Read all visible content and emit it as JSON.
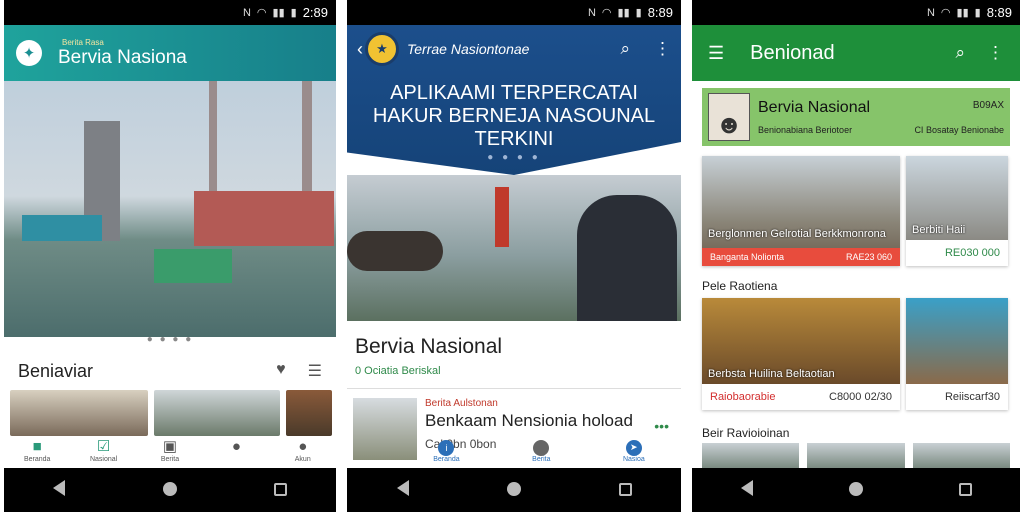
{
  "screens": [
    {
      "status_time": "2:89",
      "appbar": {
        "subtitle": "Berita Rasa",
        "title": "Bervia Nasiona"
      },
      "section": {
        "title": "Beniaviar"
      },
      "bottom_nav": [
        "Beranda",
        "Nasional",
        "Berita",
        "",
        "Akun"
      ]
    },
    {
      "status_time": "8:89",
      "appbar": {
        "title": "Terrae Nasiontonae"
      },
      "headline": "APLIKAAMI TERPERCATAI HAKUR BERNEJA NASOUNAL TERKINI",
      "card": {
        "title": "Bervia Nasional",
        "subtitle": "0 Ociatia Beriskal"
      },
      "list_item": {
        "source": "Berita Aulstonan",
        "title": "Benkaam Nensionia hoload",
        "meta": "Cal 0bn 0bon"
      },
      "bottom_nav": [
        "Beranda",
        "",
        "Berita",
        "Nasioa"
      ]
    },
    {
      "status_time": "8:89",
      "appbar": {
        "title": "Benionad"
      },
      "featured": {
        "title": "Bervia Nasional",
        "subtitle": "Benionabiana Beriotoer",
        "right_top": "B09AX",
        "right_bottom": "CI Bosatay Benionabe"
      },
      "card_a": {
        "caption": "Berglonmen Gelrotial Berkkmonrona",
        "bar_left": "Banganta Nolionta",
        "bar_right": "RAE23 060"
      },
      "card_b": {
        "caption": "Berbiti Haii",
        "foot": "RE030 000"
      },
      "section_1": "Pele Raotiena",
      "card_c": {
        "caption": "Berbsta Huilina Beltaotian",
        "foot_left": "Raiobaorabie",
        "foot_right": "C8000 02/30"
      },
      "card_d": {
        "foot": "Reiiscarf30"
      },
      "section_2": "Beir Ravioioinan"
    }
  ]
}
